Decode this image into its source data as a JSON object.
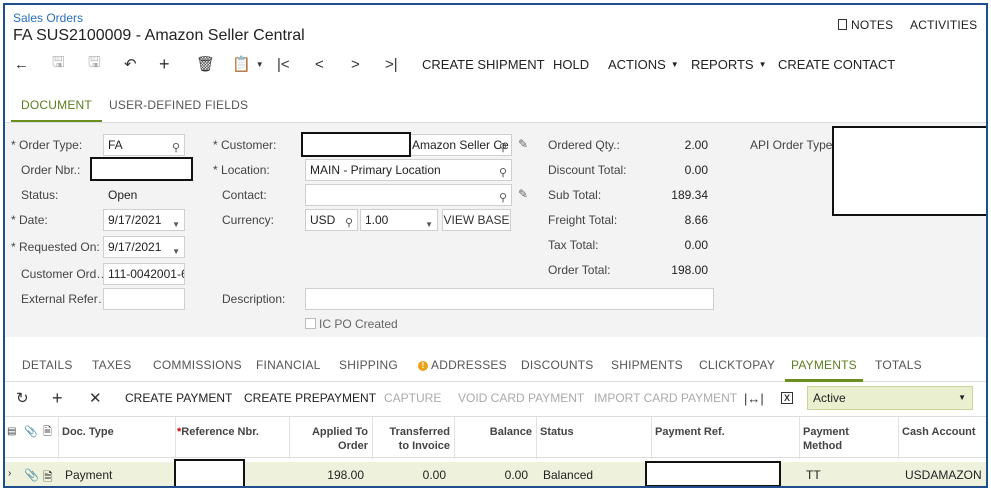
{
  "header": {
    "breadcrumb": "Sales Orders",
    "title": "FA SUS2100009 - Amazon Seller Central",
    "notes_label": "NOTES",
    "activities_label": "ACTIVITIES"
  },
  "toolbar": {
    "create_shipment": "CREATE SHIPMENT",
    "hold": "HOLD",
    "actions": "ACTIONS",
    "reports": "REPORTS",
    "create_contact": "CREATE CONTACT"
  },
  "top_tabs": [
    "DOCUMENT",
    "USER-DEFINED FIELDS"
  ],
  "form": {
    "order_type_label": "Order Type:",
    "order_type_value": "FA",
    "order_nbr_label": "Order Nbr.:",
    "status_label": "Status:",
    "status_value": "Open",
    "date_label": "Date:",
    "date_value": "9/17/2021",
    "requested_on_label": "Requested On:",
    "requested_on_value": "9/17/2021",
    "customer_ord_label": "Customer Ord…",
    "customer_ord_value": "111-0042001-6",
    "external_ref_label": "External Refer…",
    "customer_label": "Customer:",
    "customer_value": "Amazon Seller Ce",
    "location_label": "Location:",
    "location_value": "MAIN - Primary Location",
    "contact_label": "Contact:",
    "currency_label": "Currency:",
    "currency_value": "USD",
    "currency_rate": "1.00",
    "view_base_label": "VIEW BASE",
    "description_label": "Description:",
    "ic_po_label": "IC PO Created",
    "ordered_qty_label": "Ordered Qty.:",
    "ordered_qty_value": "2.00",
    "discount_total_label": "Discount Total:",
    "discount_total_value": "0.00",
    "sub_total_label": "Sub Total:",
    "sub_total_value": "189.34",
    "freight_total_label": "Freight Total:",
    "freight_total_value": "8.66",
    "tax_total_label": "Tax Total:",
    "tax_total_value": "0.00",
    "order_total_label": "Order Total:",
    "order_total_value": "198.00",
    "api_order_type_label": "API Order Type:"
  },
  "detail_tabs": [
    "DETAILS",
    "TAXES",
    "COMMISSIONS",
    "FINANCIAL",
    "SHIPPING",
    "ADDRESSES",
    "DISCOUNTS",
    "SHIPMENTS",
    "CLICKTOPAY",
    "PAYMENTS",
    "TOTALS"
  ],
  "grid_toolbar": {
    "create_payment": "CREATE PAYMENT",
    "create_prepayment": "CREATE PREPAYMENT",
    "capture": "CAPTURE",
    "void_card_payment": "VOID CARD PAYMENT",
    "import_card_payment": "IMPORT CARD PAYMENT",
    "filter_value": "Active"
  },
  "grid": {
    "headers": {
      "doc_type": "Doc. Type",
      "reference_nbr": "Reference Nbr.",
      "applied_to_order_1": "Applied To",
      "applied_to_order_2": "Order",
      "transferred_1": "Transferred",
      "transferred_2": "to Invoice",
      "balance": "Balance",
      "status": "Status",
      "payment_ref": "Payment Ref.",
      "payment_method_1": "Payment",
      "payment_method_2": "Method",
      "cash_account": "Cash Account"
    },
    "rows": [
      {
        "doc_type": "Payment",
        "applied_to_order": "198.00",
        "transferred": "0.00",
        "balance": "0.00",
        "status": "Balanced",
        "payment_method": "TT",
        "cash_account": "USDAMAZON"
      }
    ]
  },
  "colors": {
    "accent": "#6a8f1e",
    "link": "#2a6ebb",
    "frame": "#1f4e8c",
    "row_highlight": "#eef2dc"
  }
}
